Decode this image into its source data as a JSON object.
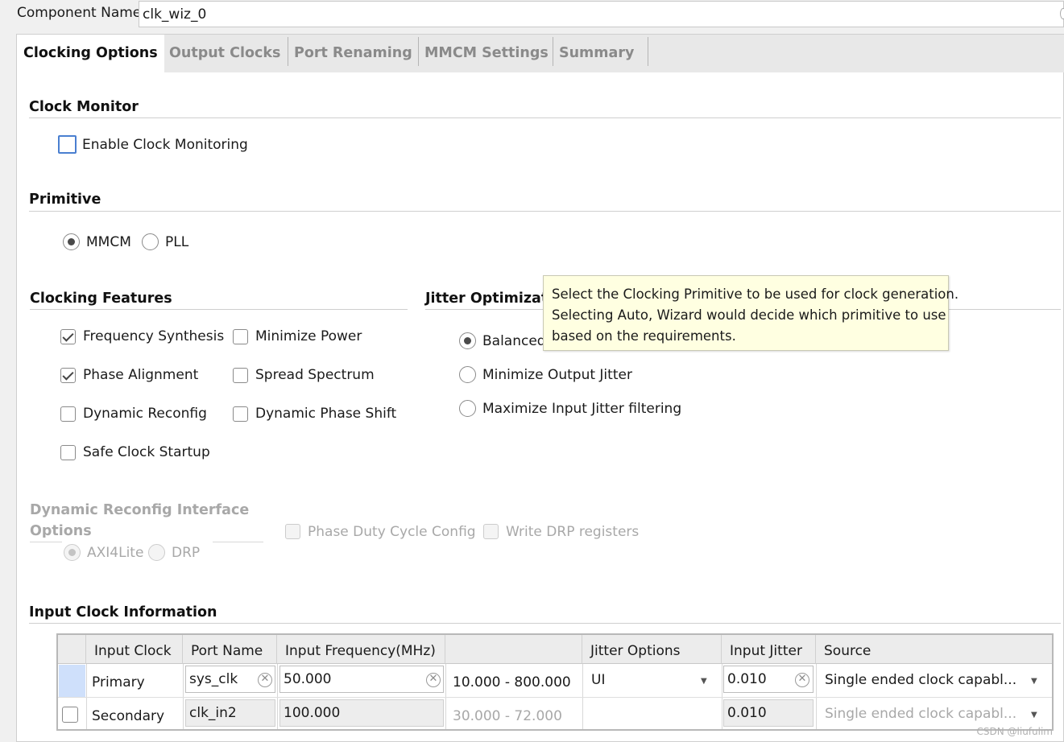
{
  "component": {
    "label": "Component Name",
    "value": "clk_wiz_0"
  },
  "tabs": [
    {
      "label": "Clocking Options",
      "active": true
    },
    {
      "label": "Output Clocks",
      "active": false
    },
    {
      "label": "Port Renaming",
      "active": false
    },
    {
      "label": "MMCM Settings",
      "active": false
    },
    {
      "label": "Summary",
      "active": false
    }
  ],
  "clock_monitor": {
    "heading": "Clock Monitor",
    "enable_label": "Enable Clock Monitoring",
    "enable_checked": false
  },
  "primitive": {
    "heading": "Primitive",
    "options": [
      {
        "label": "MMCM",
        "selected": true
      },
      {
        "label": "PLL",
        "selected": false
      }
    ]
  },
  "clocking_features": {
    "heading": "Clocking Features",
    "items": [
      {
        "label": "Frequency Synthesis",
        "checked": true
      },
      {
        "label": "Minimize Power",
        "checked": false
      },
      {
        "label": "Phase Alignment",
        "checked": true
      },
      {
        "label": "Spread Spectrum",
        "checked": false
      },
      {
        "label": "Dynamic Reconfig",
        "checked": false
      },
      {
        "label": "Dynamic Phase Shift",
        "checked": false
      },
      {
        "label": "Safe Clock Startup",
        "checked": false
      }
    ]
  },
  "jitter_optimization": {
    "heading": "Jitter Optimizatio",
    "options": [
      {
        "label": "Balanced",
        "selected": true
      },
      {
        "label": "Minimize Output Jitter",
        "selected": false
      },
      {
        "label": "Maximize Input Jitter filtering",
        "selected": false
      }
    ]
  },
  "tooltip": {
    "lines": [
      "Select the Clocking Primitive to be used for clock generation.",
      "Selecting Auto, Wizard would decide which primitive to use",
      "based on the requirements."
    ]
  },
  "drp_interface": {
    "heading_line1": "Dynamic Reconfig Interface",
    "heading_line2": "Options",
    "options": [
      {
        "label": "AXI4Lite",
        "selected": true
      },
      {
        "label": "DRP",
        "selected": false
      }
    ],
    "phase_duty_label": "Phase Duty Cycle Config",
    "write_drp_label": "Write DRP registers"
  },
  "input_clock": {
    "heading": "Input Clock Information",
    "columns": [
      "Input Clock",
      "Port Name",
      "Input Frequency(MHz)",
      "",
      "Jitter Options",
      "Input Jitter",
      "Source"
    ],
    "rows": [
      {
        "name": "Primary",
        "port": "sys_clk",
        "freq": "50.000",
        "range": "10.000 - 800.000",
        "jitter_option": "UI",
        "jitter": "0.010",
        "source": "Single ended clock capabl..."
      },
      {
        "name": "Secondary",
        "port": "clk_in2",
        "freq": "100.000",
        "range": "30.000 - 72.000",
        "jitter_option": "",
        "jitter": "0.010",
        "source": "Single ended clock capabl..."
      }
    ]
  },
  "watermark": "CSDN @liufulim"
}
